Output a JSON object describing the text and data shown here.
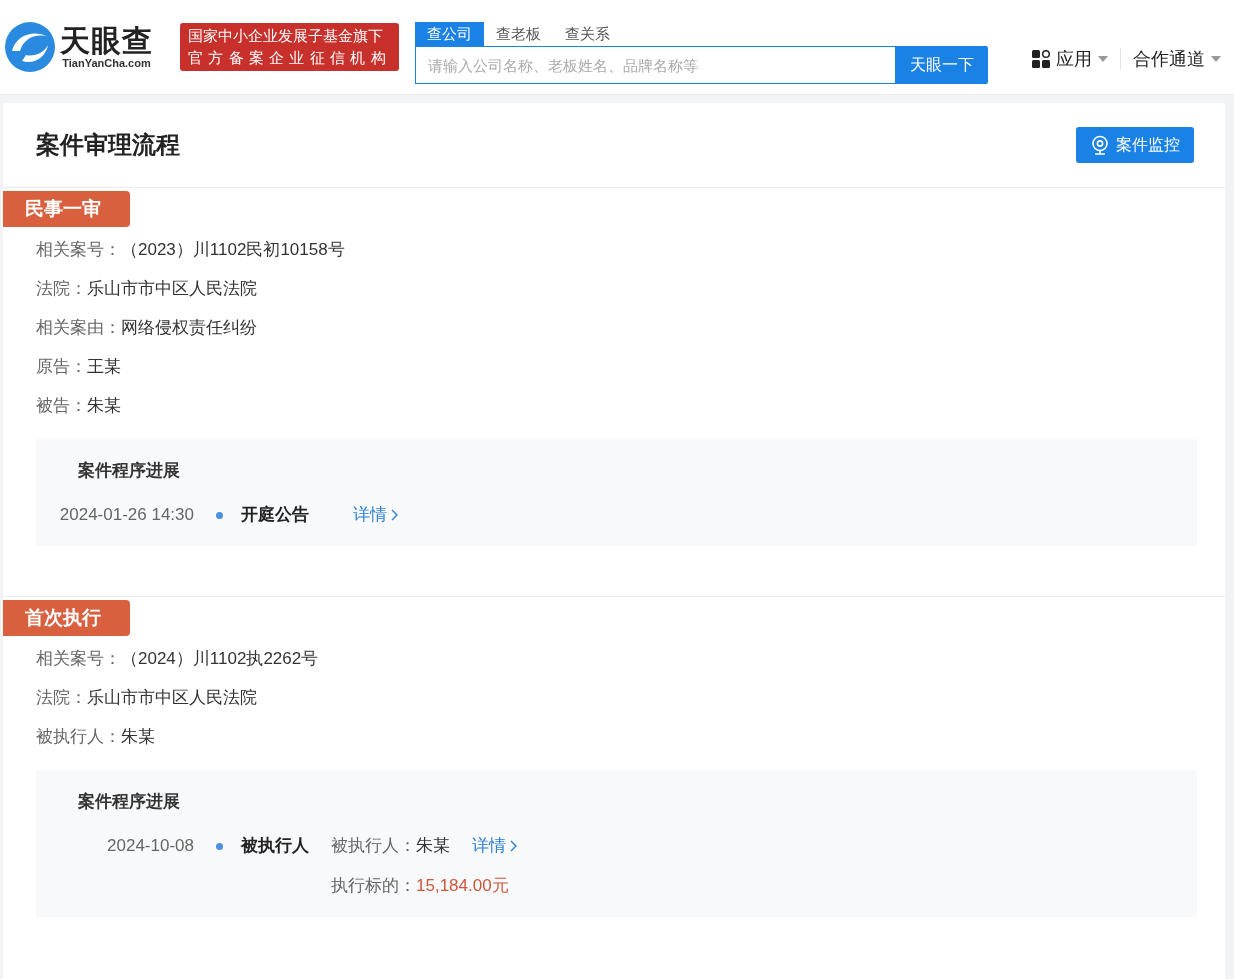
{
  "header": {
    "logo": {
      "name": "天眼查",
      "domain": "TianYanCha.com"
    },
    "badge_lines": [
      "国家中小企业发展子基金旗下",
      "官方备案企业征信机构"
    ],
    "search": {
      "tabs": [
        {
          "label": "查公司",
          "selected": true
        },
        {
          "label": "查老板",
          "selected": false
        },
        {
          "label": "查关系",
          "selected": false
        }
      ],
      "placeholder": "请输入公司名称、老板姓名、品牌名称等",
      "button": "天眼一下"
    },
    "nav": [
      {
        "label": "应用",
        "kind": "apps"
      },
      {
        "label": "合作通道",
        "kind": "plain"
      }
    ]
  },
  "card": {
    "title": "案件审理流程",
    "monitor_button": "案件监控",
    "sections": [
      {
        "tag": "民事一审",
        "fields": [
          {
            "label": "相关案号：",
            "value": "（2023）川1102民初10158号"
          },
          {
            "label": "法院：",
            "value": "乐山市市中区人民法院"
          },
          {
            "label": "相关案由：",
            "value": "网络侵权责任纠纷"
          },
          {
            "label": "原告：",
            "value": "王某"
          },
          {
            "label": "被告：",
            "value": "朱某"
          }
        ],
        "progress": {
          "title": "案件程序进展",
          "events": [
            {
              "time": "2024-01-26 14:30",
              "title": "开庭公告",
              "link": "详情"
            }
          ]
        }
      },
      {
        "tag": "首次执行",
        "fields": [
          {
            "label": "相关案号：",
            "value": "（2024）川1102执2262号"
          },
          {
            "label": "法院：",
            "value": "乐山市市中区人民法院"
          },
          {
            "label": "被执行人：",
            "value": "朱某"
          }
        ],
        "progress": {
          "title": "案件程序进展",
          "events": [
            {
              "time": "2024-10-08",
              "title": "被执行人",
              "details": [
                {
                  "label": "被执行人：",
                  "value": "朱某",
                  "highlight": false
                },
                {
                  "label": "执行标的：",
                  "value": "15,184.00元",
                  "highlight": true
                }
              ],
              "link": "详情"
            }
          ]
        }
      }
    ]
  }
}
